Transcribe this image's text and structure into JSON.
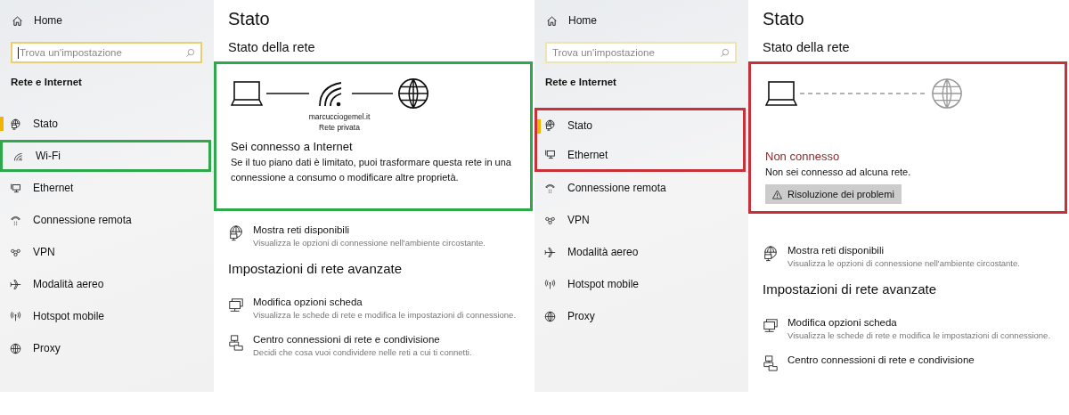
{
  "panes": [
    {
      "color": "#2ea84a",
      "sidebar": {
        "home": "Home",
        "search": {
          "placeholder": "Trova un'impostazione",
          "focused": true
        },
        "section": "Rete e Internet",
        "items": [
          {
            "kind": "status",
            "label": "Stato",
            "selected": true,
            "highlighted": false
          },
          {
            "kind": "wifi",
            "label": "Wi-Fi",
            "selected": false,
            "highlighted": true
          },
          {
            "kind": "ethernet",
            "label": "Ethernet",
            "selected": false,
            "highlighted": false
          },
          {
            "kind": "dialup",
            "label": "Connessione remota",
            "selected": false,
            "highlighted": false
          },
          {
            "kind": "vpn",
            "label": "VPN",
            "selected": false,
            "highlighted": false
          },
          {
            "kind": "airplane",
            "label": "Modalità aereo",
            "selected": false,
            "highlighted": false
          },
          {
            "kind": "hotspot",
            "label": "Hotspot mobile",
            "selected": false,
            "highlighted": false
          },
          {
            "kind": "proxy",
            "label": "Proxy",
            "selected": false,
            "highlighted": false
          }
        ]
      },
      "content": {
        "title": "Stato",
        "subtitle": "Stato della rete",
        "status": {
          "kind": "connected",
          "highlighted": true,
          "network_name": "marcucciogemel.it",
          "network_type": "Rete privata",
          "headline": "Sei connesso a Internet",
          "message": "Se il tuo piano dati è limitato, puoi trasformare questa rete in una connessione a consumo o modificare altre proprietà."
        },
        "links": [
          {
            "kind": "networks",
            "title": "Mostra reti disponibili",
            "description": "Visualizza le opzioni di connessione nell'ambiente circostante."
          }
        ],
        "advanced_heading": "Impostazioni di rete avanzate",
        "advanced_links": [
          {
            "kind": "adapter",
            "title": "Modifica opzioni scheda",
            "description": "Visualizza le schede di rete e modifica le impostazioni di connessione."
          },
          {
            "kind": "sharing",
            "title": "Centro connessioni di rete e condivisione",
            "description": "Decidi che cosa vuoi condividere nelle reti a cui ti connetti."
          }
        ]
      }
    },
    {
      "color": "#c8303a",
      "sidebar": {
        "home": "Home",
        "search": {
          "placeholder": "Trova un'impostazione",
          "focused": false
        },
        "section": "Rete e Internet",
        "items": [
          {
            "kind": "status",
            "label": "Stato",
            "selected": true,
            "highlighted": true
          },
          {
            "kind": "ethernet",
            "label": "Ethernet",
            "selected": false,
            "highlighted": true
          },
          {
            "kind": "dialup",
            "label": "Connessione remota",
            "selected": false,
            "highlighted": false
          },
          {
            "kind": "vpn",
            "label": "VPN",
            "selected": false,
            "highlighted": false
          },
          {
            "kind": "airplane",
            "label": "Modalità aereo",
            "selected": false,
            "highlighted": false
          },
          {
            "kind": "hotspot",
            "label": "Hotspot mobile",
            "selected": false,
            "highlighted": false
          },
          {
            "kind": "proxy",
            "label": "Proxy",
            "selected": false,
            "highlighted": false
          }
        ]
      },
      "content": {
        "title": "Stato",
        "subtitle": "Stato della rete",
        "status": {
          "kind": "disconnected",
          "highlighted": true,
          "headline": "Non connesso",
          "message": "Non sei connesso ad alcuna rete.",
          "button": "Risoluzione dei problemi"
        },
        "links": [
          {
            "kind": "networks",
            "title": "Mostra reti disponibili",
            "description": "Visualizza le opzioni di connessione nell'ambiente circostante."
          }
        ],
        "advanced_heading": "Impostazioni di rete avanzate",
        "advanced_links": [
          {
            "kind": "adapter",
            "title": "Modifica opzioni scheda",
            "description": "Visualizza le schede di rete e modifica le impostazioni di connessione."
          },
          {
            "kind": "sharing",
            "title": "Centro connessioni di rete e condivisione"
          }
        ]
      }
    }
  ]
}
